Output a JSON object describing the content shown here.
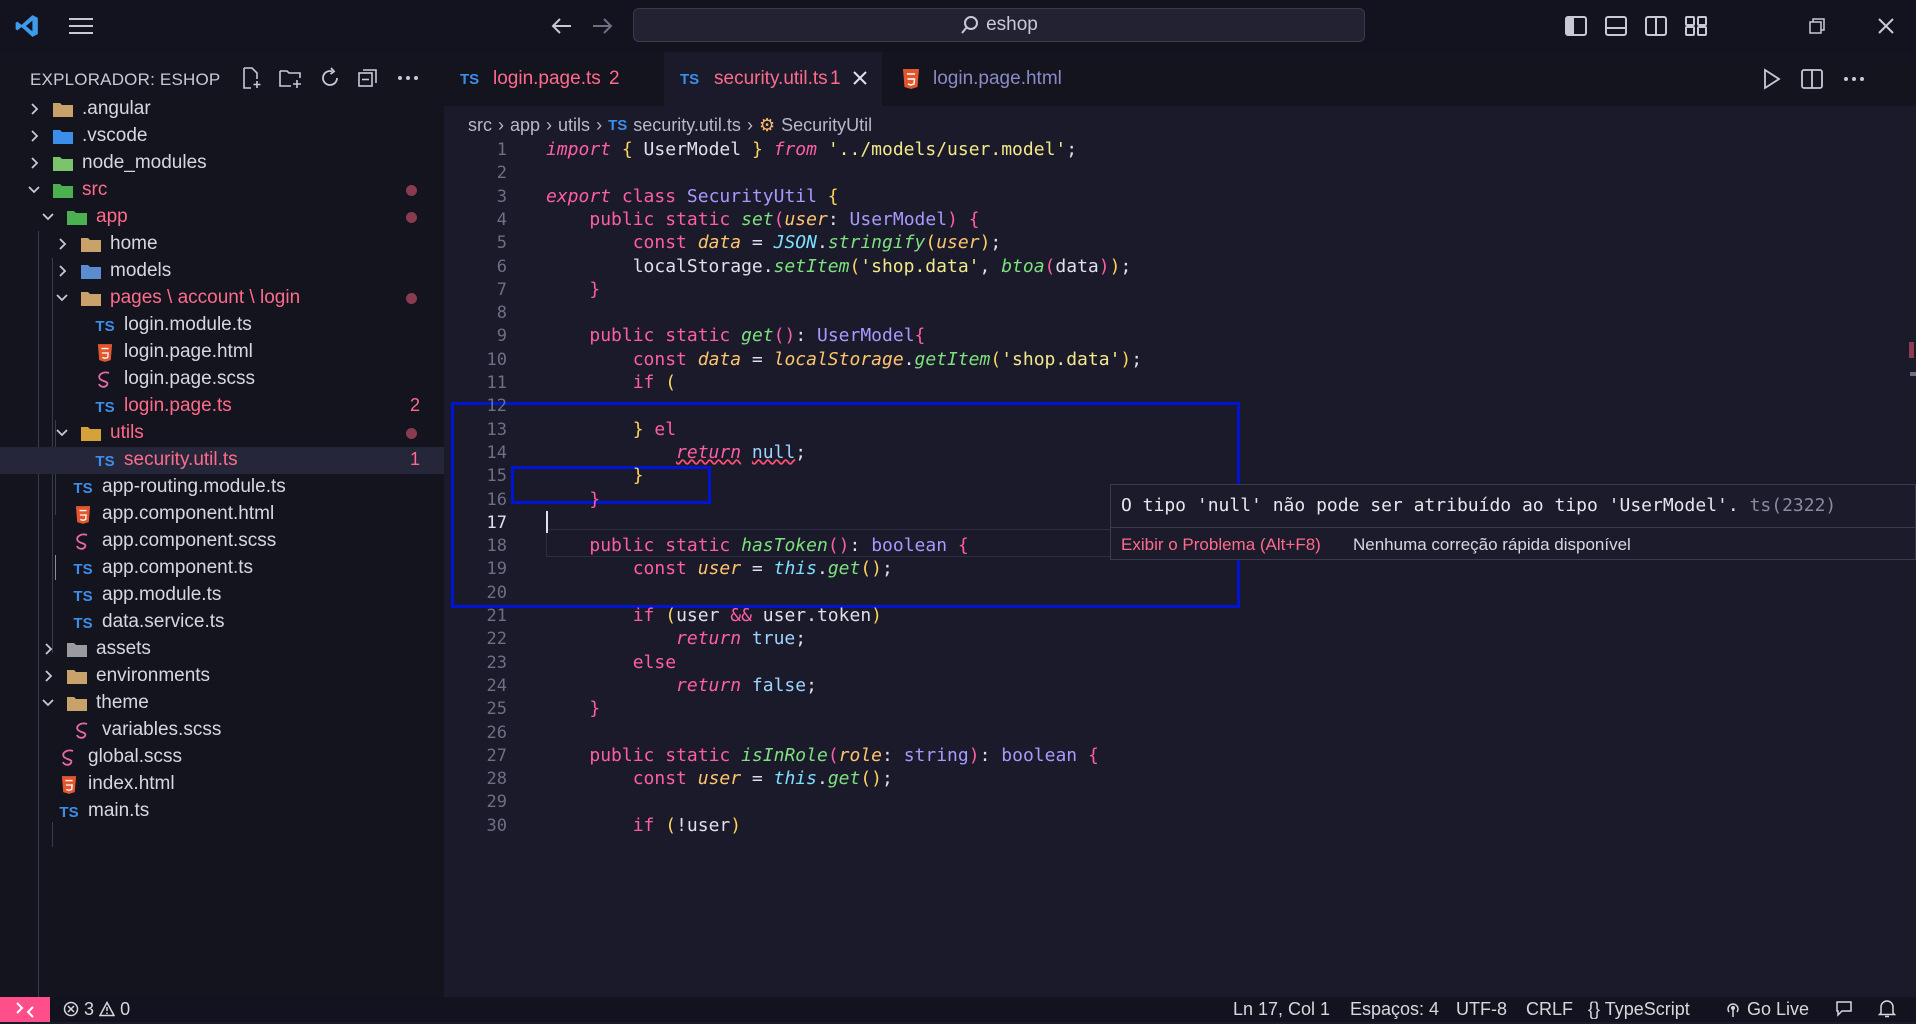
{
  "titlebar": {
    "search_text": "eshop"
  },
  "explorer": {
    "title": "EXPLORADOR: ESHOP",
    "tree": [
      {
        "label": ".angular",
        "state": "collapsed",
        "icon": "folder-angular-icon",
        "indent": 0
      },
      {
        "label": ".vscode",
        "state": "collapsed",
        "icon": "folder-vscode-icon",
        "indent": 0
      },
      {
        "label": "node_modules",
        "state": "collapsed",
        "icon": "folder-node-icon",
        "indent": 0
      },
      {
        "label": "src",
        "state": "expanded",
        "icon": "folder-src-icon",
        "indent": 0,
        "modified": true
      },
      {
        "label": "app",
        "state": "expanded",
        "icon": "folder-app-icon",
        "indent": 1,
        "modified": true
      },
      {
        "label": "home",
        "state": "collapsed",
        "icon": "folder-icon",
        "indent": 2
      },
      {
        "label": "models",
        "state": "collapsed",
        "icon": "folder-models-icon",
        "indent": 2
      },
      {
        "label": "pages \\ account \\ login",
        "state": "expanded",
        "icon": "folder-open-icon",
        "indent": 2,
        "modified": true
      },
      {
        "label": "login.module.ts",
        "icon": "ts-file-icon",
        "indent": 3
      },
      {
        "label": "login.page.html",
        "icon": "html-file-icon",
        "indent": 3
      },
      {
        "label": "login.page.scss",
        "icon": "scss-file-icon",
        "indent": 3
      },
      {
        "label": "login.page.ts",
        "icon": "ts-file-icon",
        "indent": 3,
        "count": "2"
      },
      {
        "label": "utils",
        "state": "expanded",
        "icon": "folder-utils-icon",
        "indent": 2,
        "modified": true
      },
      {
        "label": "security.util.ts",
        "icon": "ts-file-icon",
        "indent": 3,
        "count": "1",
        "selected": true
      },
      {
        "label": "app-routing.module.ts",
        "icon": "ts-file-icon",
        "indent": 2
      },
      {
        "label": "app.component.html",
        "icon": "html-file-icon",
        "indent": 2
      },
      {
        "label": "app.component.scss",
        "icon": "scss-file-icon",
        "indent": 2
      },
      {
        "label": "app.component.ts",
        "icon": "ts-file-icon",
        "indent": 2
      },
      {
        "label": "app.module.ts",
        "icon": "ts-file-icon",
        "indent": 2
      },
      {
        "label": "data.service.ts",
        "icon": "ts-file-icon",
        "indent": 2
      },
      {
        "label": "assets",
        "state": "collapsed",
        "icon": "folder-assets-icon",
        "indent": 1
      },
      {
        "label": "environments",
        "state": "collapsed",
        "icon": "folder-icon",
        "indent": 1
      },
      {
        "label": "theme",
        "state": "expanded",
        "icon": "folder-theme-icon",
        "indent": 1
      },
      {
        "label": "variables.scss",
        "icon": "scss-file-icon",
        "indent": 2
      },
      {
        "label": "global.scss",
        "icon": "scss-file-icon",
        "indent": 1
      },
      {
        "label": "index.html",
        "icon": "html-file-icon",
        "indent": 1
      },
      {
        "label": "main.ts",
        "icon": "ts-file-icon",
        "indent": 1
      }
    ]
  },
  "tabs": [
    {
      "label": "login.page.ts",
      "badge": "2",
      "icon": "TS",
      "error": true
    },
    {
      "label": "security.util.ts",
      "badge": "1",
      "icon": "TS",
      "error": true,
      "active": true
    },
    {
      "label": "login.page.html",
      "badge": "",
      "icon": "html",
      "error": false
    }
  ],
  "breadcrumbs": [
    "src",
    "app",
    "utils",
    "security.util.ts",
    "SecurityUtil"
  ],
  "code": {
    "current_line": 17,
    "line_numbers": [
      "1",
      "2",
      "3",
      "4",
      "5",
      "6",
      "7",
      "8",
      "9",
      "10",
      "11",
      "12",
      "13",
      "14",
      "15",
      "16",
      "17",
      "18",
      "19",
      "20",
      "21",
      "22",
      "23",
      "24",
      "25",
      "26",
      "27",
      "28",
      "29",
      "30"
    ]
  },
  "hover": {
    "message": "O tipo 'null' não pode ser atribuído ao tipo 'UserModel'.",
    "code": "ts(2322)",
    "action_link": "Exibir o Problema (Alt+F8)",
    "no_fix": "Nenhuma correção rápida disponível"
  },
  "status": {
    "errors": "3",
    "warnings": "0",
    "position": "Ln 17, Col 1",
    "spaces": "Espaços: 4",
    "encoding": "UTF-8",
    "eol": "CRLF",
    "language": "TypeScript",
    "golive": "Go Live"
  },
  "colors": {
    "accent": "#ff4f8b",
    "highlight_box": "#0014d6",
    "error": "#ff6b8b"
  }
}
